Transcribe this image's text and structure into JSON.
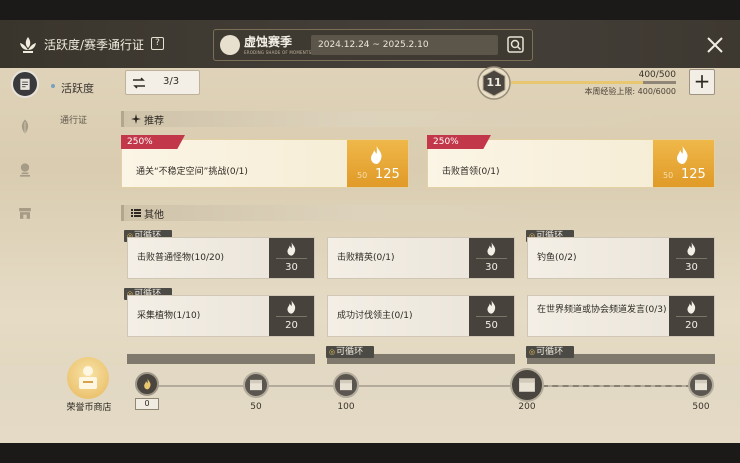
{
  "header": {
    "title": "活跃度/赛季通行证",
    "season_name": "虚蚀赛季",
    "season_subtitle": "ERODING SHADE OF MOMENTS",
    "season_dates": "2024.12.24 ~ 2025.2.10"
  },
  "nav": {
    "sub_active": "活跃度",
    "sub_normal": "通行证"
  },
  "counter": {
    "value": "3/3"
  },
  "level": {
    "value": "11",
    "xp_text": "400/500",
    "xp_fraction": 0.8,
    "weekly_cap": "本周经验上限: 400/6000"
  },
  "sections": {
    "recommended": "推荐",
    "others": "其他"
  },
  "recommended": [
    {
      "pct": "250%",
      "name": "通关“不稳定空间”挑战(0/1)",
      "old": "50",
      "new": "125"
    },
    {
      "pct": "250%",
      "name": "击败首领(0/1)",
      "old": "50",
      "new": "125"
    }
  ],
  "loop_label": "可循环",
  "tasks": [
    {
      "name": "击败普通怪物(10/20)",
      "pts": "30"
    },
    {
      "name": "击败精英(0/1)",
      "pts": "30"
    },
    {
      "name": "钓鱼(0/2)",
      "pts": "30"
    },
    {
      "name": "采集植物(1/10)",
      "pts": "20"
    },
    {
      "name": "成功讨伐领主(0/1)",
      "pts": "50"
    },
    {
      "name": "在世界频道或协会频道发言(0/3)",
      "pts": "20"
    }
  ],
  "shop": {
    "label": "荣誉币商店"
  },
  "progress": {
    "current": "0",
    "milestones": [
      "50",
      "100",
      "200",
      "500"
    ]
  },
  "colors": {
    "accent_gold": "#e8c770",
    "pct_tag": "#c2384a",
    "reward_orange": "#e09a27",
    "reward_dark": "#47423c"
  }
}
